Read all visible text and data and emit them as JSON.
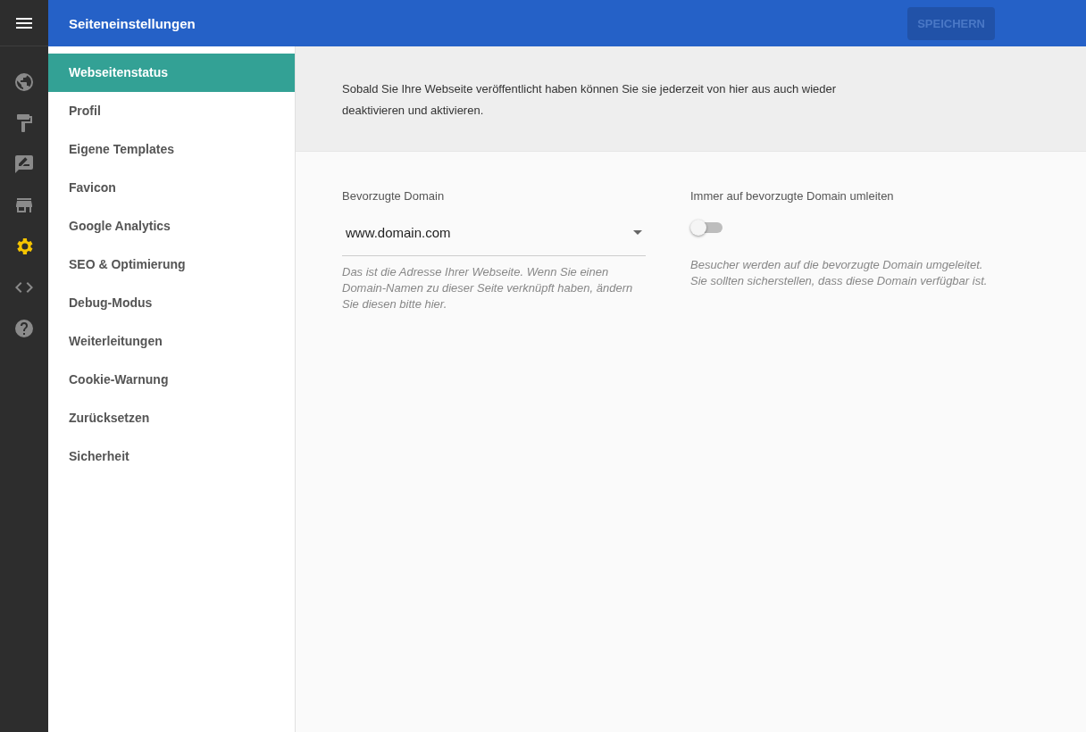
{
  "rail": {
    "items": [
      {
        "kind": "globe",
        "selected": false
      },
      {
        "kind": "roller",
        "selected": false
      },
      {
        "kind": "feedback",
        "selected": false
      },
      {
        "kind": "store",
        "selected": false
      },
      {
        "kind": "gear",
        "selected": true
      },
      {
        "kind": "code",
        "selected": false
      },
      {
        "kind": "help",
        "selected": false
      }
    ]
  },
  "top_bar": {
    "title": "Seiteneinstellungen",
    "save_button": {
      "label": "SPEICHERN",
      "disabled": true
    }
  },
  "sidebar": {
    "items": [
      {
        "label": "Webseitenstatus",
        "selected": true
      },
      {
        "label": "Profil",
        "selected": false
      },
      {
        "label": "Eigene Templates",
        "selected": false
      },
      {
        "label": "Favicon",
        "selected": false
      },
      {
        "label": "Google Analytics",
        "selected": false
      },
      {
        "label": "SEO & Optimierung",
        "selected": false
      },
      {
        "label": "Debug-Modus",
        "selected": false
      },
      {
        "label": "Weiterleitungen",
        "selected": false
      },
      {
        "label": "Cookie-Warnung",
        "selected": false
      },
      {
        "label": "Zurücksetzen",
        "selected": false
      },
      {
        "label": "Sicherheit",
        "selected": false
      }
    ]
  },
  "info": "Sobald Sie Ihre Webseite veröffentlicht haben können Sie sie jederzeit von hier aus auch wieder deaktivieren und aktivieren.",
  "domain_field": {
    "label": "Bevorzugte Domain",
    "value": "www.domain.com",
    "hint": "Das ist die Adresse Ihrer Webseite. Wenn Sie einen Domain-Namen zu dieser Seite verknüpft haben, ändern Sie diesen bitte hier."
  },
  "redirect": {
    "label": "Immer auf bevorzugte Domain umleiten",
    "on": false,
    "hint": "Besucher werden auf die bevorzugte Domain umgeleitet. Sie sollten sicherstellen, dass diese Domain verfügbar ist."
  }
}
